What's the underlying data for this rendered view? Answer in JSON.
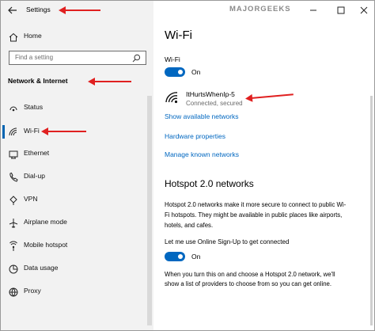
{
  "window": {
    "title": "Settings"
  },
  "watermark": "MAJORGEEKS",
  "sidebar": {
    "home_label": "Home",
    "search_placeholder": "Find a setting",
    "section_title": "Network & Internet",
    "items": [
      {
        "label": "Status",
        "icon": "status-icon",
        "selected": false
      },
      {
        "label": "Wi-Fi",
        "icon": "wifi-icon",
        "selected": true
      },
      {
        "label": "Ethernet",
        "icon": "ethernet-icon",
        "selected": false
      },
      {
        "label": "Dial-up",
        "icon": "dialup-icon",
        "selected": false
      },
      {
        "label": "VPN",
        "icon": "vpn-icon",
        "selected": false
      },
      {
        "label": "Airplane mode",
        "icon": "airplane-icon",
        "selected": false
      },
      {
        "label": "Mobile hotspot",
        "icon": "mobile-hotspot-icon",
        "selected": false
      },
      {
        "label": "Data usage",
        "icon": "data-usage-icon",
        "selected": false
      },
      {
        "label": "Proxy",
        "icon": "proxy-icon",
        "selected": false
      }
    ]
  },
  "main": {
    "page_title": "Wi-Fi",
    "wifi_label": "Wi-Fi",
    "wifi_toggle_state": "On",
    "network_name": "ItHurtsWhenIp-5",
    "network_status": "Connected, secured",
    "links": {
      "show_available": "Show available networks",
      "hardware_properties": "Hardware properties",
      "manage_known": "Manage known networks"
    },
    "hotspot_title": "Hotspot 2.0 networks",
    "hotspot_desc_1": "Hotspot 2.0 networks make it more secure to connect to public Wi-",
    "hotspot_desc_2": "Fi hotspots. They might be available in public places like airports,",
    "hotspot_desc_3": "hotels, and cafes.",
    "online_signup_label": "Let me use Online Sign-Up to get connected",
    "online_signup_state": "On",
    "footer_1": "When you turn this on and choose a Hotspot 2.0 network, we'll",
    "footer_2": "show a list of providers to choose from so you can get online."
  },
  "colors": {
    "accent": "#0067c0",
    "annotation_arrow": "#e02020"
  }
}
